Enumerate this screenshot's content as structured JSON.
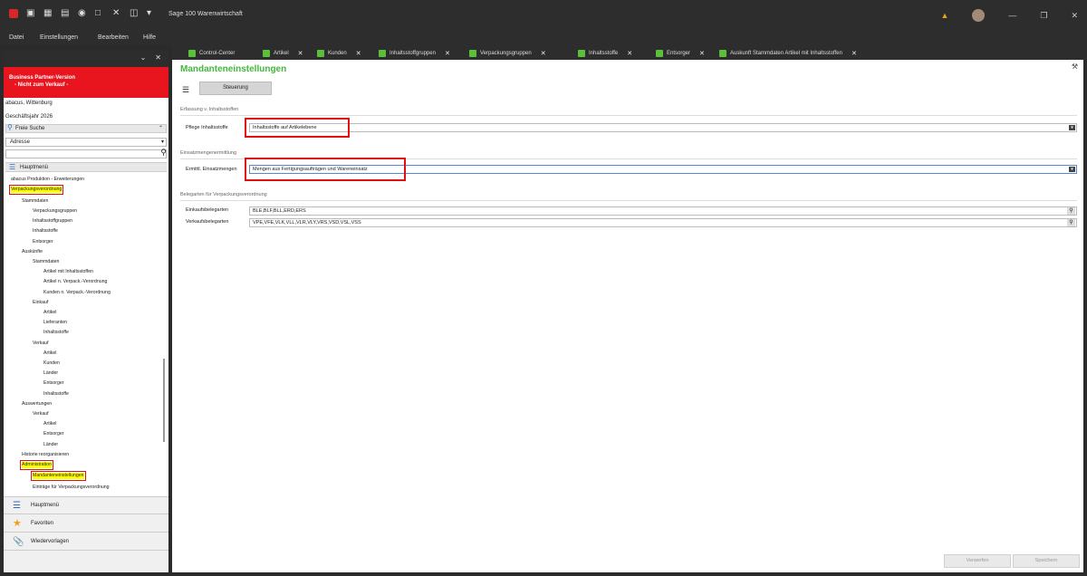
{
  "window": {
    "title": "Sage 100 Warenwirtschaft"
  },
  "menu": [
    "Datei",
    "Einstellungen",
    "Bearbeiten",
    "Hilfe"
  ],
  "tabs": [
    {
      "label": "Control-Center"
    },
    {
      "label": "Artikel"
    },
    {
      "label": "Kunden"
    },
    {
      "label": "Inhaltsstoffgruppen"
    },
    {
      "label": "Verpackungsgruppen"
    },
    {
      "label": "Inhaltsstoffe"
    },
    {
      "label": "Entsorger"
    },
    {
      "label": "Auskunft Stammdaten Artikel mit Inhaltsstoffen"
    }
  ],
  "sidebar": {
    "banner_line1": "Business Partner-Version",
    "banner_line2": "- Nicht zum Verkauf -",
    "company": "abacus, Wittenburg",
    "fiscal_year": "Geschäftsjahr 2026",
    "search_header": "Freie Suche",
    "search_field": "Adresse",
    "search_value": "",
    "menu_header": "Hauptmenü",
    "tree": [
      {
        "label": "abacus Produktion - Erweiterungen",
        "level": 0
      },
      {
        "label": "Verpackungsverordnung",
        "level": 0,
        "highlight": true
      },
      {
        "label": "Stammdaten",
        "level": 1
      },
      {
        "label": "Verpackungsgruppen",
        "level": 2
      },
      {
        "label": "Inhaltsstoffgruppen",
        "level": 2
      },
      {
        "label": "Inhaltsstoffe",
        "level": 2
      },
      {
        "label": "Entsorger",
        "level": 2
      },
      {
        "label": "Auskünfte",
        "level": 1
      },
      {
        "label": "Stammdaten",
        "level": 2
      },
      {
        "label": "Artikel mit Inhaltsstoffen",
        "level": 3
      },
      {
        "label": "Artikel n. Verpack.-Verordnung",
        "level": 3
      },
      {
        "label": "Kunden n. Verpack.-Verordnung",
        "level": 3
      },
      {
        "label": "Einkauf",
        "level": 2
      },
      {
        "label": "Artikel",
        "level": 3
      },
      {
        "label": "Lieferanten",
        "level": 3
      },
      {
        "label": "Inhaltsstoffe",
        "level": 3
      },
      {
        "label": "Verkauf",
        "level": 2
      },
      {
        "label": "Artikel",
        "level": 3
      },
      {
        "label": "Kunden",
        "level": 3
      },
      {
        "label": "Länder",
        "level": 3
      },
      {
        "label": "Entsorger",
        "level": 3
      },
      {
        "label": "Inhaltsstoffe",
        "level": 3
      },
      {
        "label": "Auswertungen",
        "level": 1
      },
      {
        "label": "Verkauf",
        "level": 2
      },
      {
        "label": "Artikel",
        "level": 3
      },
      {
        "label": "Entsorger",
        "level": 3
      },
      {
        "label": "Länder",
        "level": 3
      },
      {
        "label": "Historie reorganisieren",
        "level": 1
      },
      {
        "label": "Administration",
        "level": 1,
        "highlight": true
      },
      {
        "label": "Mandanteneinstellungen",
        "level": 2,
        "highlight": true
      },
      {
        "label": "Einträge für Verpackungsverordnung",
        "level": 2
      }
    ],
    "bottom": [
      {
        "label": "Hauptmenü",
        "icon": "list-icon"
      },
      {
        "label": "Favoriten",
        "icon": "star-icon"
      },
      {
        "label": "Wiedervorlagen",
        "icon": "paperclip-icon"
      }
    ]
  },
  "main": {
    "title": "Mandanteneinstellungen",
    "tab_label": "Steuerung",
    "sections": [
      {
        "title": "Erfassung v. Inhaltsstoffen",
        "fields": [
          {
            "label": "Pflege Inhaltsstoffe",
            "value": "Inhaltsstoffe auf Artikelebene",
            "type": "select"
          }
        ]
      },
      {
        "title": "Einsatzmengenermittlung",
        "fields": [
          {
            "label": "Ermittl. Einsatzmengen",
            "value": "Mengen aus Fertigungsaufträgen und Wareneinsatz",
            "type": "select"
          }
        ]
      },
      {
        "title": "Belegarten für Verpackungsverordnung",
        "fields": [
          {
            "label": "Einkaufsbelegarten",
            "value": "BLE,BLF,BLL,ERD,ERS",
            "type": "lookup"
          },
          {
            "label": "Verkaufsbelegarten",
            "value": "VPE,VFE,VLK,VLL,VLR,VLY,VRS,VSD,VSL,VSS",
            "type": "lookup"
          }
        ]
      }
    ],
    "buttons": {
      "discard": "Verwerfen",
      "save": "Speichern"
    }
  },
  "colors": {
    "accent_green": "#44b83c",
    "banner_red": "#e8141e",
    "highlight_yellow": "#ffff00",
    "mark_red": "#e01010"
  }
}
